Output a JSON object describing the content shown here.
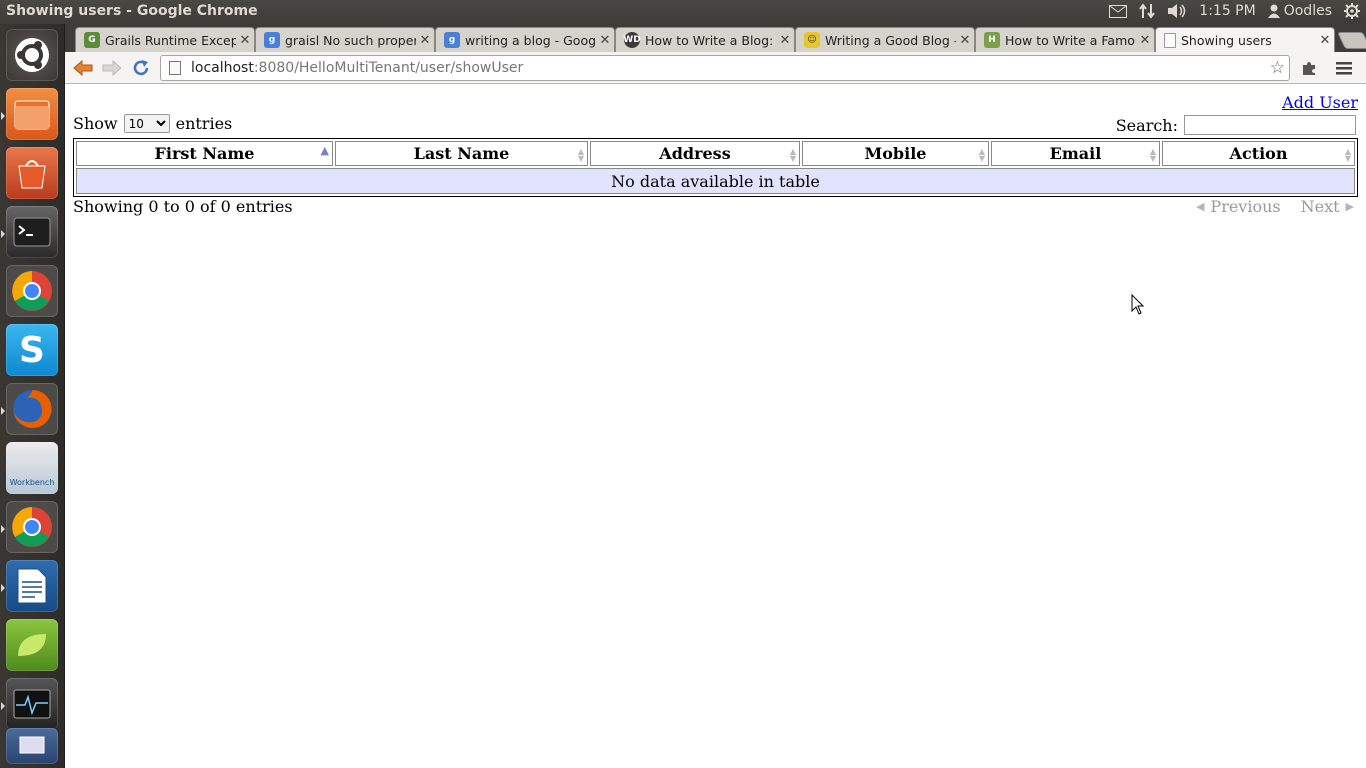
{
  "system": {
    "window_title": "Showing users - Google Chrome",
    "clock": "1:15 PM",
    "user": "Oodles"
  },
  "browser": {
    "tabs": [
      {
        "label": "Grails Runtime Exceptio",
        "favicon": "grails-icon",
        "color": "#5c8c3a"
      },
      {
        "label": "graisl No such property",
        "favicon": "google-icon",
        "color": "#4a7fd6"
      },
      {
        "label": "writing a blog - Google",
        "favicon": "google-icon",
        "color": "#4a7fd6"
      },
      {
        "label": "How to Write a Blog: Th",
        "favicon": "wd-icon",
        "color": "#3b3b3b"
      },
      {
        "label": "Writing a Good Blog - F",
        "favicon": "blog-icon",
        "color": "#e8c630"
      },
      {
        "label": "How to Write a Famous",
        "favicon": "wikihow-icon",
        "color": "#7aa04a"
      },
      {
        "label": "Showing users",
        "favicon": "page-icon",
        "color": "#ffffff"
      }
    ],
    "url_host": "localhost",
    "url_path": ":8080/HelloMultiTenant/user/showUser"
  },
  "page": {
    "add_user": "Add User",
    "show_label": "Show",
    "entries_label": "entries",
    "length_value": "10",
    "search_label": "Search:",
    "search_value": "",
    "columns": [
      "First Name",
      "Last Name",
      "Address",
      "Mobile",
      "Email",
      "Action"
    ],
    "empty_message": "No data available in table",
    "info": "Showing 0 to 0 of 0 entries",
    "previous": "Previous",
    "next": "Next"
  }
}
